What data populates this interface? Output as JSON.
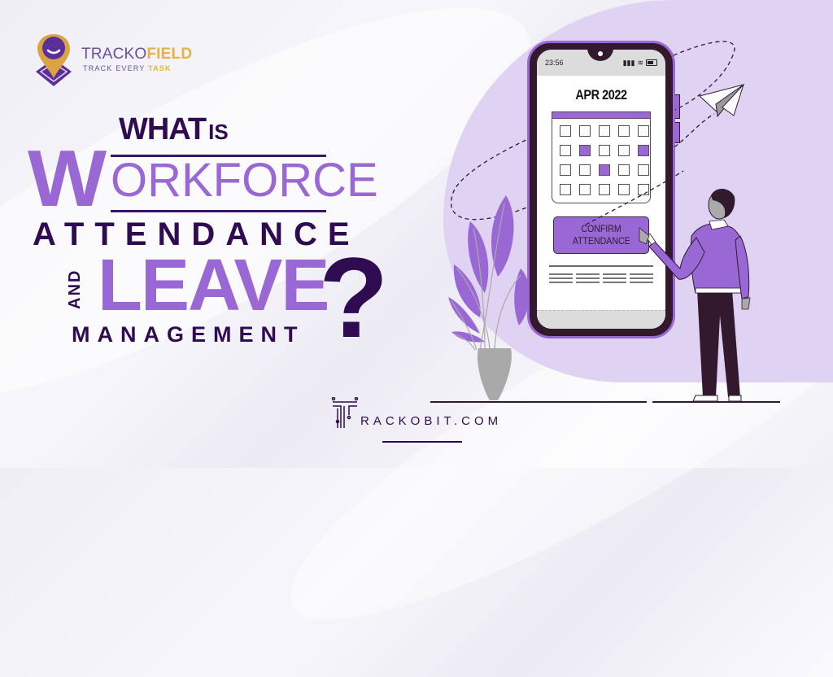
{
  "brand": {
    "name_part1": "TRACKO",
    "name_part2": "FIELD",
    "tagline_part1": "TRACK EVERY ",
    "tagline_part2": "TASK",
    "accent_gold": "#e6b23e",
    "accent_purple": "#9a68d4",
    "dark_purple": "#2f0b52"
  },
  "headline": {
    "what": "WHAT",
    "is": "IS",
    "big_w": "W",
    "orkforce": "ORKFORCE",
    "attendance": "ATTENDANCE",
    "and": "AND",
    "leave": "LEAVE",
    "question_mark": "?",
    "management": "MANAGEMENT"
  },
  "phone": {
    "time": "23:56",
    "status_icons": [
      "signal-icon",
      "wifi-icon",
      "battery-icon"
    ],
    "month": "APR 2022",
    "calendar": {
      "rows": 4,
      "cols": 5,
      "marked_days": [
        [
          1,
          1
        ],
        [
          1,
          4
        ],
        [
          2,
          2
        ]
      ]
    },
    "confirm_button": {
      "line1": "CONFIRM",
      "line2": "ATTENDANCE"
    }
  },
  "footer": {
    "site_letter_icon": "trackobit-t-icon",
    "site_text": "RACKOBIT.COM"
  }
}
